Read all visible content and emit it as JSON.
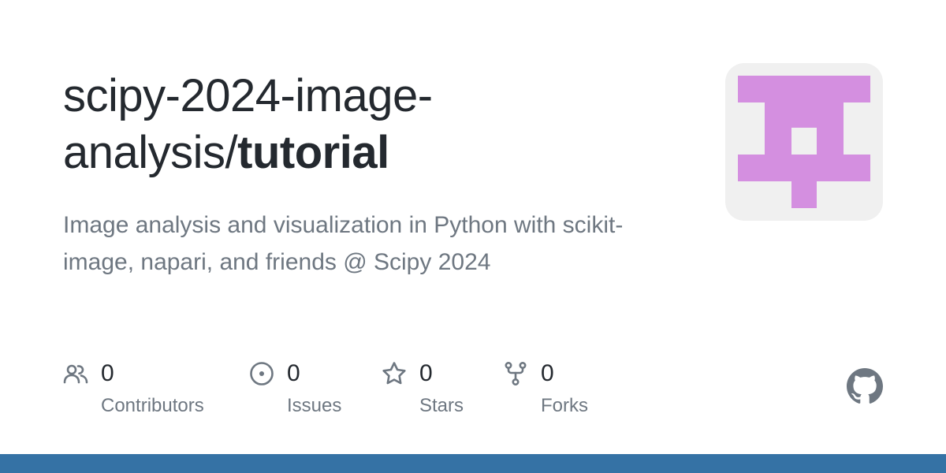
{
  "repo": {
    "owner": "scipy-2024-image-analysis/",
    "name": "tutorial",
    "description": "Image analysis and visualization in Python with scikit-image, napari, and friends @ Scipy 2024"
  },
  "stats": [
    {
      "icon": "people-icon",
      "count": "0",
      "label": "Contributors"
    },
    {
      "icon": "issue-opened-icon",
      "count": "0",
      "label": "Issues"
    },
    {
      "icon": "star-icon",
      "count": "0",
      "label": "Stars"
    },
    {
      "icon": "repo-forked-icon",
      "count": "0",
      "label": "Forks"
    }
  ],
  "colors": {
    "title": "#24292f",
    "muted": "#6e7781",
    "avatar_background": "#f0f0f0",
    "avatar_glyph": "#d48fe0",
    "bottom_bar": "#3572a5"
  },
  "logo": "github-mark-icon"
}
